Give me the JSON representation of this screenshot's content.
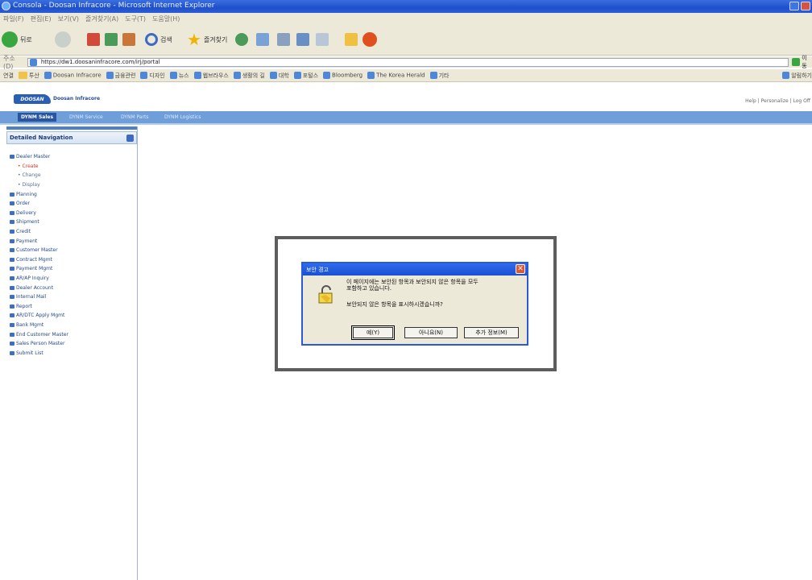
{
  "browser": {
    "window_title": "Consola - Doosan Infracore - Microsoft Internet Explorer",
    "menu": [
      "파일(F)",
      "편집(E)",
      "보기(V)",
      "즐겨찾기(A)",
      "도구(T)",
      "도움말(H)"
    ],
    "back_label": "뒤로",
    "search_label": "검색",
    "favorites_label": "즐겨찾기",
    "address_label": "주소(D)",
    "address_url": "https://dw1.doosaninfracore.com/irj/portal",
    "go_label": "이동",
    "links_label": "연결",
    "links": [
      "투산",
      "Doosan Infracore",
      "금융관련",
      "디자인",
      "뉴스",
      "웹브라우스",
      "생활의 길",
      "대학",
      "포털스",
      "Bloomberg",
      "The Korea Herald",
      "기타"
    ],
    "links_extra": "알림하기"
  },
  "portal": {
    "logo_text": "DOOSAN",
    "brand": "Doosan Infracore",
    "header_links": "Help | Personalize | Log Off",
    "tabs": [
      "DYNM Sales",
      "DYNM Service",
      "DYNM Parts",
      "DYNM Logistics"
    ],
    "nav_title": "Detailed Navigation",
    "nav_items": [
      {
        "label": "Dealer Master",
        "level": 0,
        "active": false
      },
      {
        "label": "Create",
        "level": 1,
        "active": true
      },
      {
        "label": "Change",
        "level": 1,
        "active": false
      },
      {
        "label": "Display",
        "level": 1,
        "active": false
      },
      {
        "label": "Planning",
        "level": 0,
        "active": false
      },
      {
        "label": "Order",
        "level": 0,
        "active": false
      },
      {
        "label": "Delivery",
        "level": 0,
        "active": false
      },
      {
        "label": "Shipment",
        "level": 0,
        "active": false
      },
      {
        "label": "Credit",
        "level": 0,
        "active": false
      },
      {
        "label": "Payment",
        "level": 0,
        "active": false
      },
      {
        "label": "Customer Master",
        "level": 0,
        "active": false
      },
      {
        "label": "Contract Mgmt",
        "level": 0,
        "active": false
      },
      {
        "label": "Payment Mgmt",
        "level": 0,
        "active": false
      },
      {
        "label": "AR/AP Inquiry",
        "level": 0,
        "active": false
      },
      {
        "label": "Dealer Account",
        "level": 0,
        "active": false
      },
      {
        "label": "Internal Mail",
        "level": 0,
        "active": false
      },
      {
        "label": "Report",
        "level": 0,
        "active": false
      },
      {
        "label": "AR/DTC Apply Mgmt",
        "level": 0,
        "active": false
      },
      {
        "label": "Bank Mgmt",
        "level": 0,
        "active": false
      },
      {
        "label": "End Customer Master",
        "level": 0,
        "active": false
      },
      {
        "label": "Sales Person Master",
        "level": 0,
        "active": false
      },
      {
        "label": "Submit List",
        "level": 0,
        "active": false
      }
    ]
  },
  "dialog": {
    "title": "보안 경고",
    "message_line1": "이 페이지에는 보안된 항목과 보안되지 않은 항목을 모두",
    "message_line2": "포함하고 있습니다.",
    "question": "보안되지 않은 항목을 표시하시겠습니까?",
    "buttons": {
      "yes": "예(Y)",
      "no": "아니요(N)",
      "more_info": "추가 정보(M)"
    }
  }
}
